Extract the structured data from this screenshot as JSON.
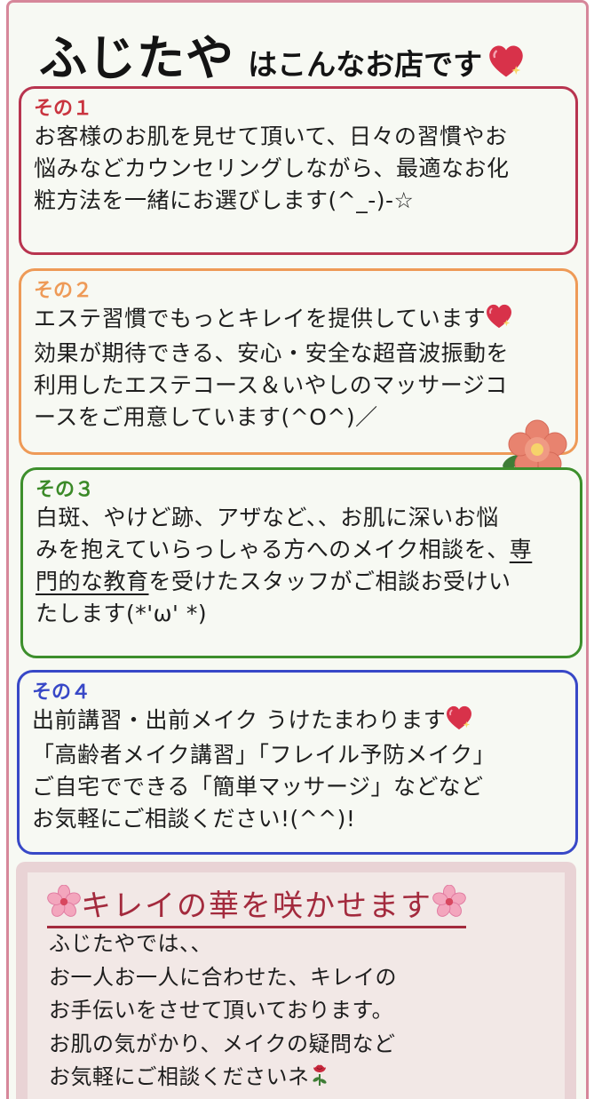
{
  "header": {
    "brand": "ふじたや",
    "tagline": "はこんなお店です",
    "heart_icon": "sparkling-heart-icon"
  },
  "cards": [
    {
      "number": "その１",
      "color": "#b8344f",
      "lines": [
        "お客様のお肌を見せて頂いて、日々の習慣やお",
        "悩みなどカウンセリングしながら、最適なお化",
        "粧方法を一緒にお選びします(^_-)-☆"
      ]
    },
    {
      "number": "その２",
      "color": "#ee9a57",
      "lines": [
        "エステ習慣でもっとキレイを提供しています",
        "効果が期待できる、安心・安全な超音波振動を",
        "利用したエステコース＆いやしのマッサージコ",
        "ースをご用意しています(^O^)／"
      ]
    },
    {
      "number": "その３",
      "color": "#3d8f2c",
      "lines": [
        "白斑、やけど跡、アザなど、、お肌に深いお悩",
        "みを抱えていらっしゃる方へのメイク相談を、",
        "専",
        "門的な教育",
        "を受けたスタッフがご相談お受けい",
        "たします(*'ω' *)"
      ]
    },
    {
      "number": "その４",
      "color": "#3848c7",
      "lines": [
        "出前講習・出前メイク うけたまわります",
        "「高齢者メイク講習」「フレイル予防メイク」",
        "ご自宅でできる「簡単マッサージ」などなど",
        "お気軽にご相談ください!(^^)!"
      ]
    }
  ],
  "bottom": {
    "title": "キレイの華を咲かせます",
    "icons": [
      "cherry-blossom-icon",
      "rose-icon"
    ],
    "lines": [
      "ふじたやでは、、",
      "お一人お一人に合わせた、キレイの",
      "お手伝いをさせて頂いております。",
      "お肌の気がかり、メイクの疑問など",
      "お気軽にご相談くださいネ"
    ]
  }
}
